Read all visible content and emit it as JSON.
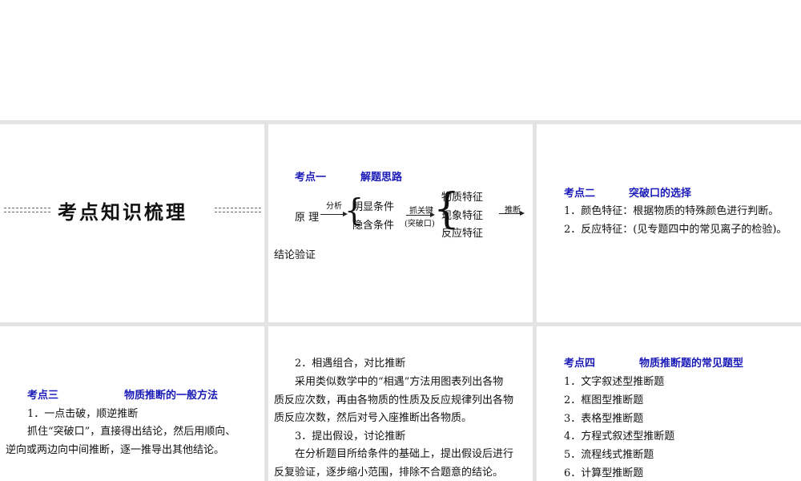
{
  "slides": {
    "s1": {
      "title": "考点知识梳理"
    },
    "s2": {
      "heading_num": "考点一",
      "heading_title": "解题思路",
      "start": "原 理",
      "arrow1": "分析",
      "cond1": "明显条件",
      "cond2": "隐含条件",
      "arrow2_top": "抓关键",
      "arrow2_bottom": "(突破口)",
      "feat1": "物质特征",
      "feat2": "现象特征",
      "feat3": "反应特征",
      "arrow3": "推断",
      "end": "结论验证"
    },
    "s3": {
      "heading_num": "考点二",
      "heading_title": "突破口的选择",
      "items": [
        "1．颜色特征：根据物质的特殊颜色进行判断。",
        "2．反应特征：(见专题四中的常见离子的检验)。"
      ]
    },
    "s4": {
      "heading_num": "考点三",
      "heading_title": "物质推断的一般方法",
      "sub1": "1．一点击破，顺逆推断",
      "p1a": "抓住“突破口”，直接得出结论，然后用顺向、",
      "p1b": "逆向或两边向中间推断，逐一推导出其他结论。"
    },
    "s5": {
      "sub2": "2．相遇组合，对比推断",
      "p2a": "采用类似数学中的“相遇”方法用图表列出各物",
      "p2b": "质反应次数，再由各物质的性质及反应规律列出各物",
      "p2c": "质反应次数，然后对号入座推断出各物质。",
      "sub3": "3．提出假设，讨论推断",
      "p3a": "在分析题目所给条件的基础上，提出假设后进行",
      "p3b": "反复验证，逐步缩小范围，排除不合题意的结论。"
    },
    "s6": {
      "heading_num": "考点四",
      "heading_title": "物质推断题的常见题型",
      "items": [
        "1．文字叙述型推断题",
        "2．框图型推断题",
        "3．表格型推断题",
        "4．方程式叙述型推断题",
        "5．流程线式推断题",
        "6．计算型推断题"
      ]
    }
  }
}
